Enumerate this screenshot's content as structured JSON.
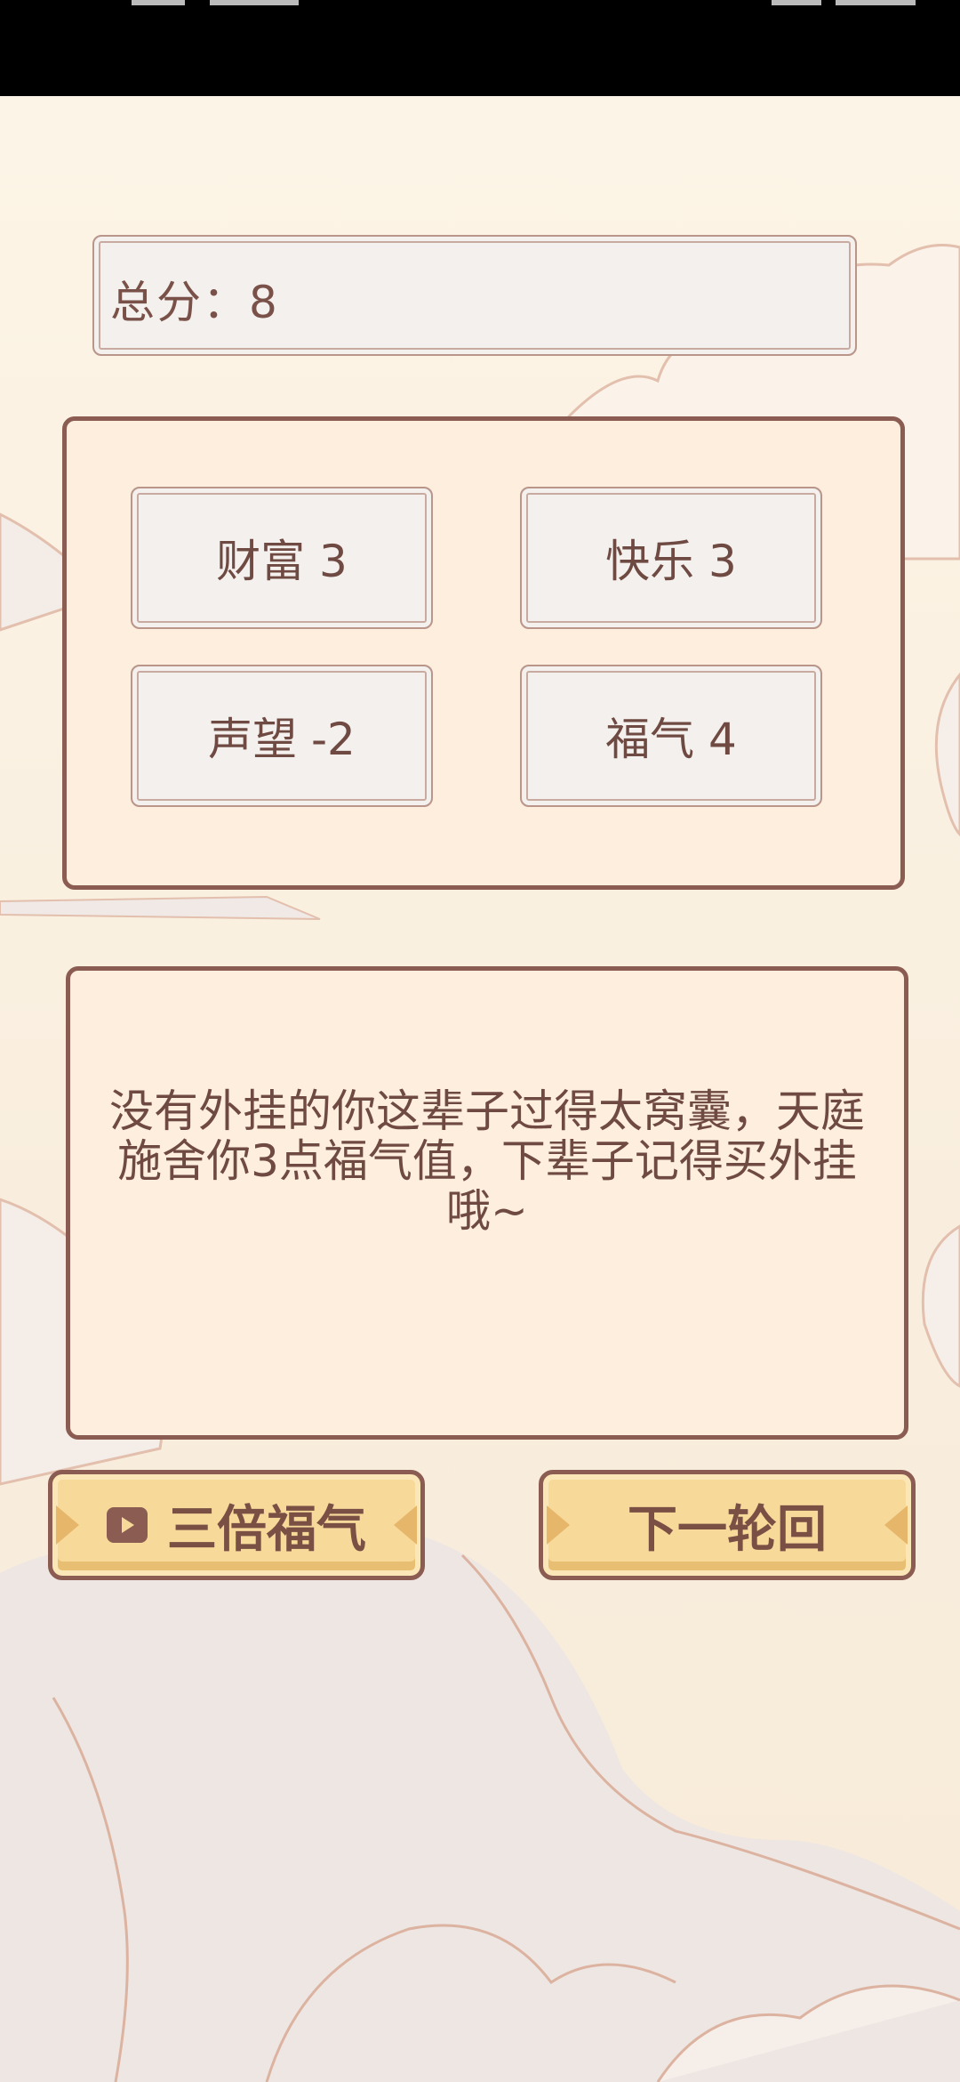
{
  "score": {
    "text": "总分：8"
  },
  "stats": [
    {
      "text": "财富 3"
    },
    {
      "text": "快乐 3"
    },
    {
      "text": "声望 -2"
    },
    {
      "text": "福气 4"
    }
  ],
  "message": {
    "text": "没有外挂的你这辈子过得太窝囊，天庭施舍你3点福气值，下辈子记得买外挂哦~"
  },
  "buttons": {
    "triple_label": "三倍福气",
    "next_label": "下一轮回"
  },
  "icons": {
    "video": "video-icon"
  },
  "colors": {
    "background": "#fbf1e3",
    "panel": "#fdeede",
    "border": "#8a5c52",
    "button": "#f7d99a",
    "text": "#6f4a42"
  }
}
